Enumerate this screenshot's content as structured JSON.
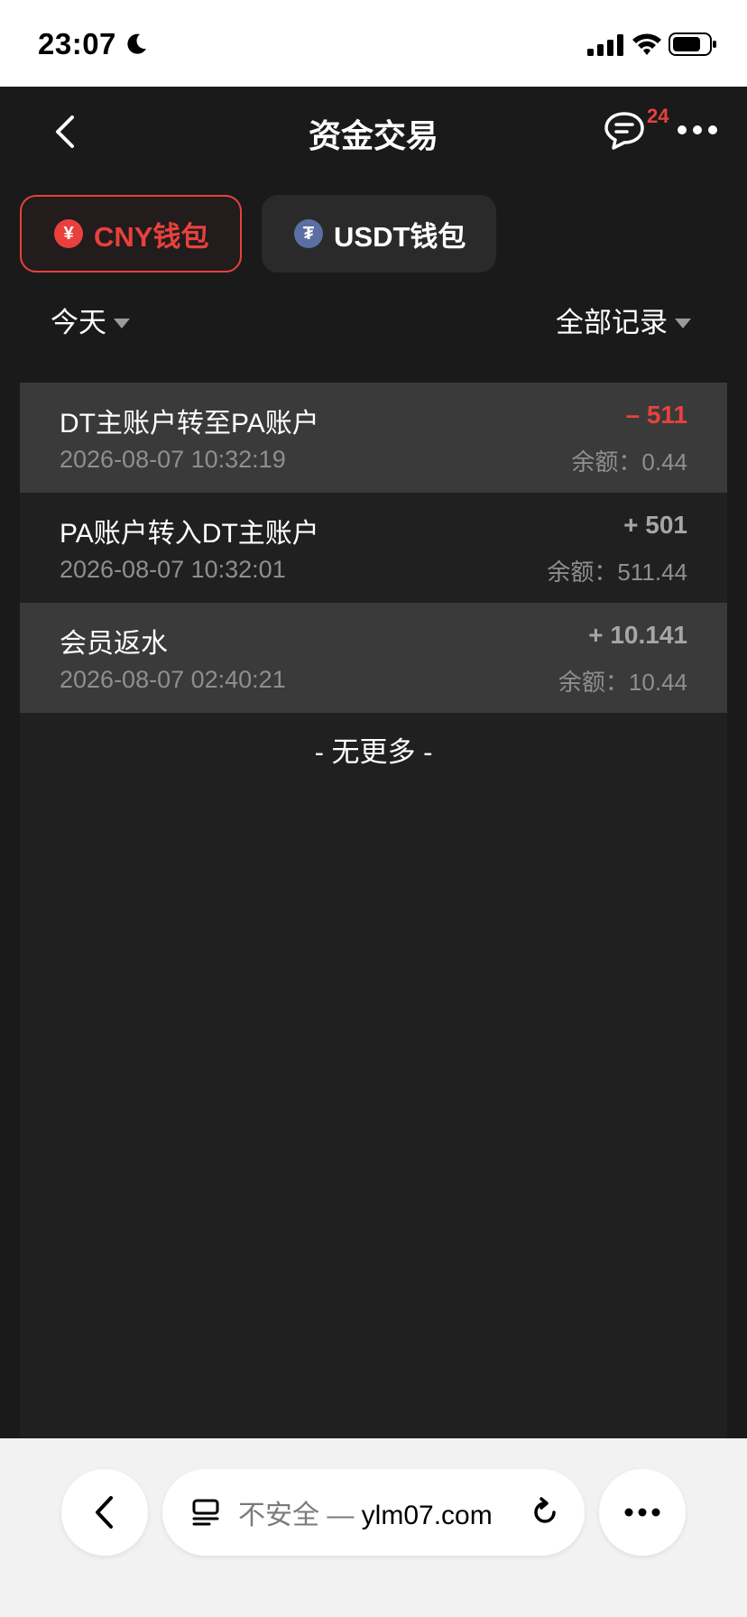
{
  "status_bar": {
    "time": "23:07"
  },
  "header": {
    "title": "资金交易",
    "badge_count": "24"
  },
  "wallets": [
    {
      "label": "CNY钱包",
      "symbol": "¥",
      "active": true
    },
    {
      "label": "USDT钱包",
      "symbol": "₮",
      "active": false
    }
  ],
  "filters": {
    "date": "今天",
    "type": "全部记录"
  },
  "transactions": [
    {
      "title": "DT主账户转至PA账户",
      "time": "2026-08-07 10:32:19",
      "amount": "– 511",
      "balance": "余额：0.44"
    },
    {
      "title": "PA账户转入DT主账户",
      "time": "2026-08-07 10:32:01",
      "amount": "+ 501",
      "balance": "余额：511.44"
    },
    {
      "title": "会员返水",
      "time": "2026-08-07 02:40:21",
      "amount": "+ 10.141",
      "balance": "余额：10.44"
    }
  ],
  "list_footer": "- 无更多 -",
  "browser": {
    "insecure_label": "不安全",
    "separator": " — ",
    "domain": "ylm07.com"
  },
  "colors": {
    "accent": "#e8413d",
    "background": "#1a1a1a",
    "row_alt": "#3a3a3a"
  }
}
